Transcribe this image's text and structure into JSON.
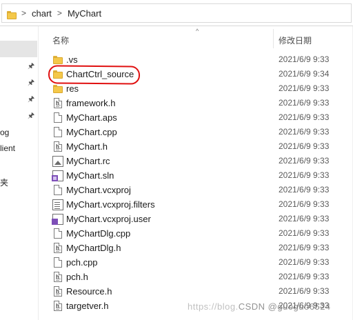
{
  "address": {
    "separator": ">",
    "crumbs": [
      "chart",
      "MyChart"
    ]
  },
  "nav": {
    "labels": [
      "og",
      "lient",
      "夹"
    ]
  },
  "columns": {
    "name": "名称",
    "date": "修改日期",
    "sort_indicator": "^"
  },
  "files": [
    {
      "name": ".vs",
      "date": "2021/6/9 9:33",
      "icon": "folder-icon"
    },
    {
      "name": "ChartCtrl_source",
      "date": "2021/6/9 9:34",
      "icon": "folder-icon"
    },
    {
      "name": "res",
      "date": "2021/6/9 9:33",
      "icon": "folder-icon"
    },
    {
      "name": "framework.h",
      "date": "2021/6/9 9:33",
      "icon": "header-file-icon"
    },
    {
      "name": "MyChart.aps",
      "date": "2021/6/9 9:33",
      "icon": "file-icon"
    },
    {
      "name": "MyChart.cpp",
      "date": "2021/6/9 9:33",
      "icon": "file-icon"
    },
    {
      "name": "MyChart.h",
      "date": "2021/6/9 9:33",
      "icon": "header-file-icon"
    },
    {
      "name": "MyChart.rc",
      "date": "2021/6/9 9:33",
      "icon": "resource-file-icon"
    },
    {
      "name": "MyChart.sln",
      "date": "2021/6/9 9:33",
      "icon": "solution-file-icon"
    },
    {
      "name": "MyChart.vcxproj",
      "date": "2021/6/9 9:33",
      "icon": "project-file-icon"
    },
    {
      "name": "MyChart.vcxproj.filters",
      "date": "2021/6/9 9:33",
      "icon": "filters-file-icon"
    },
    {
      "name": "MyChart.vcxproj.user",
      "date": "2021/6/9 9:33",
      "icon": "user-file-icon"
    },
    {
      "name": "MyChartDlg.cpp",
      "date": "2021/6/9 9:33",
      "icon": "file-icon"
    },
    {
      "name": "MyChartDlg.h",
      "date": "2021/6/9 9:33",
      "icon": "header-file-icon"
    },
    {
      "name": "pch.cpp",
      "date": "2021/6/9 9:33",
      "icon": "file-icon"
    },
    {
      "name": "pch.h",
      "date": "2021/6/9 9:33",
      "icon": "header-file-icon"
    },
    {
      "name": "Resource.h",
      "date": "2021/6/9 9:33",
      "icon": "header-file-icon"
    },
    {
      "name": "targetver.h",
      "date": "2021/6/9 9:33",
      "icon": "header-file-icon"
    }
  ],
  "watermark": {
    "site": "https://blog.",
    "brand": "CSDN @guoguo6524"
  },
  "colors": {
    "annotation": "#e01010",
    "folder": "#f4c84a",
    "vs_purple": "#7e4fb8"
  }
}
